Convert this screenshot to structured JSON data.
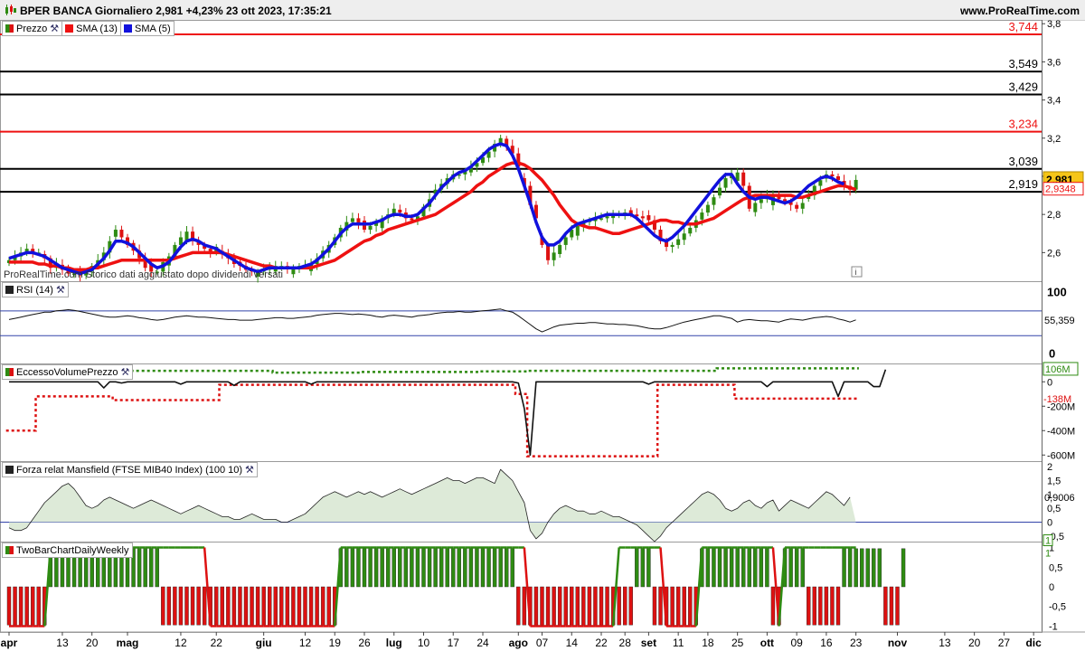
{
  "header": {
    "title": "BPER BANCA Giornaliero 2,981 +4,23% 23 ott 2023, 17:35:21",
    "site": "www.ProRealTime.com"
  },
  "watermark": "ProRealTime.com Storico dati aggiustato dopo dividendi versati",
  "colors": {
    "up": "#2e8b12",
    "down": "#dd1111",
    "sma13": "#ee1111",
    "sma5": "#1111dd",
    "hline_red": "#ee1111",
    "hline_black": "#000000",
    "rsi_band": "#3344aa",
    "area": "#d9e8d4",
    "mansfield_line": "#222222"
  },
  "x_axis": {
    "labels": [
      {
        "t": "apr",
        "d": 0,
        "m": true
      },
      {
        "t": "13",
        "d": 9
      },
      {
        "t": "20",
        "d": 14
      },
      {
        "t": "mag",
        "d": 20,
        "m": true
      },
      {
        "t": "12",
        "d": 29
      },
      {
        "t": "22",
        "d": 35
      },
      {
        "t": "giu",
        "d": 43,
        "m": true
      },
      {
        "t": "12",
        "d": 50
      },
      {
        "t": "19",
        "d": 55
      },
      {
        "t": "26",
        "d": 60
      },
      {
        "t": "lug",
        "d": 65,
        "m": true
      },
      {
        "t": "10",
        "d": 70
      },
      {
        "t": "17",
        "d": 75
      },
      {
        "t": "24",
        "d": 80
      },
      {
        "t": "ago",
        "d": 86,
        "m": true
      },
      {
        "t": "07",
        "d": 90
      },
      {
        "t": "14",
        "d": 95
      },
      {
        "t": "22",
        "d": 100
      },
      {
        "t": "28",
        "d": 104
      },
      {
        "t": "set",
        "d": 108,
        "m": true
      },
      {
        "t": "11",
        "d": 113
      },
      {
        "t": "18",
        "d": 118
      },
      {
        "t": "25",
        "d": 123
      },
      {
        "t": "ott",
        "d": 128,
        "m": true
      },
      {
        "t": "09",
        "d": 133
      },
      {
        "t": "16",
        "d": 138
      },
      {
        "t": "23",
        "d": 143
      },
      {
        "t": "nov",
        "d": 150,
        "m": true
      },
      {
        "t": "13",
        "d": 158
      },
      {
        "t": "20",
        "d": 163
      },
      {
        "t": "27",
        "d": 168
      },
      {
        "t": "dic",
        "d": 173,
        "m": true
      }
    ]
  },
  "panels": {
    "price": {
      "legend": [
        "Prezzo",
        "SMA (13)",
        "SMA (5)"
      ],
      "ticks": [
        "3,8",
        "3,6",
        "3,4",
        "3,2",
        "3",
        "2,8",
        "2,6"
      ],
      "hlines": [
        {
          "label": "3,744",
          "value": 3.744,
          "color": "red"
        },
        {
          "label": "3,549",
          "value": 3.549,
          "color": "black"
        },
        {
          "label": "3,429",
          "value": 3.429,
          "color": "black"
        },
        {
          "label": "3,234",
          "value": 3.234,
          "color": "red"
        },
        {
          "label": "3,039",
          "value": 3.039,
          "color": "black"
        },
        {
          "label": "2,919",
          "value": 2.919,
          "color": "black"
        }
      ],
      "last_price": "2,981",
      "sma13_last": "2,9348",
      "info_icon": "i"
    },
    "rsi": {
      "legend": "RSI (14)",
      "ticks": [
        "100",
        "0"
      ],
      "value": "55,359",
      "upper": 70,
      "lower": 30
    },
    "evp": {
      "legend": "EccessoVolumePrezzo",
      "ticks": [
        "0",
        "-200M",
        "-400M",
        "-600M"
      ],
      "upper_label": "106M",
      "lower_label": "-138M"
    },
    "mansfield": {
      "legend": "Forza relat Mansfield (FTSE MIB40 Index) (100 10)",
      "ticks": [
        "2",
        "1,5",
        "1",
        "0,5",
        "0",
        "-0,5"
      ],
      "value": "0,9006"
    },
    "twobar": {
      "legend": "TwoBarChartDailyWeekly",
      "ticks": [
        "1",
        "0,5",
        "0",
        "-0,5",
        "-1"
      ],
      "label_a": "1",
      "label_b": "1"
    }
  },
  "chart_data": [
    {
      "type": "candlestick",
      "title": "BPER BANCA Giornaliero",
      "ylim": [
        2.45,
        3.82
      ],
      "x_unit": "trading day index",
      "close": [
        2.56,
        2.58,
        2.6,
        2.62,
        2.6,
        2.6,
        2.57,
        2.52,
        2.54,
        2.51,
        2.49,
        2.49,
        2.48,
        2.5,
        2.53,
        2.56,
        2.6,
        2.66,
        2.72,
        2.68,
        2.64,
        2.61,
        2.57,
        2.52,
        2.5,
        2.5,
        2.55,
        2.58,
        2.64,
        2.68,
        2.71,
        2.66,
        2.64,
        2.62,
        2.6,
        2.63,
        2.59,
        2.57,
        2.54,
        2.53,
        2.51,
        2.5,
        2.5,
        2.51,
        2.52,
        2.53,
        2.53,
        2.52,
        2.52,
        2.53,
        2.53,
        2.54,
        2.57,
        2.61,
        2.64,
        2.68,
        2.73,
        2.76,
        2.78,
        2.75,
        2.72,
        2.74,
        2.76,
        2.78,
        2.8,
        2.83,
        2.81,
        2.78,
        2.77,
        2.79,
        2.84,
        2.88,
        2.93,
        2.96,
        2.99,
        3.01,
        3.01,
        3.03,
        3.05,
        3.07,
        3.1,
        3.13,
        3.17,
        3.2,
        3.16,
        3.12,
        3.05,
        2.95,
        2.85,
        2.78,
        2.64,
        2.56,
        2.6,
        2.64,
        2.68,
        2.72,
        2.74,
        2.76,
        2.77,
        2.78,
        2.78,
        2.79,
        2.8,
        2.8,
        2.81,
        2.8,
        2.79,
        2.78,
        2.77,
        2.72,
        2.66,
        2.63,
        2.64,
        2.67,
        2.7,
        2.73,
        2.77,
        2.81,
        2.85,
        2.89,
        2.94,
        2.99,
        3.01,
        3.02,
        2.95,
        2.83,
        2.86,
        2.88,
        2.9,
        2.9,
        2.88,
        2.87,
        2.85,
        2.83,
        2.86,
        2.9,
        2.95,
        2.98,
        3.01,
        3.0,
        2.98,
        2.95,
        2.93,
        2.981
      ],
      "sma13": [
        2.55,
        2.55,
        2.55,
        2.55,
        2.55,
        2.54,
        2.54,
        2.53,
        2.53,
        2.52,
        2.52,
        2.51,
        2.51,
        2.51,
        2.52,
        2.52,
        2.53,
        2.54,
        2.55,
        2.56,
        2.56,
        2.56,
        2.56,
        2.56,
        2.56,
        2.56,
        2.56,
        2.56,
        2.57,
        2.58,
        2.59,
        2.6,
        2.6,
        2.6,
        2.6,
        2.6,
        2.6,
        2.59,
        2.58,
        2.57,
        2.56,
        2.55,
        2.54,
        2.53,
        2.53,
        2.52,
        2.52,
        2.52,
        2.52,
        2.52,
        2.52,
        2.52,
        2.53,
        2.54,
        2.55,
        2.56,
        2.58,
        2.6,
        2.62,
        2.64,
        2.66,
        2.67,
        2.69,
        2.7,
        2.72,
        2.73,
        2.74,
        2.75,
        2.76,
        2.77,
        2.78,
        2.79,
        2.8,
        2.82,
        2.84,
        2.86,
        2.88,
        2.9,
        2.92,
        2.95,
        2.97,
        3.0,
        3.02,
        3.04,
        3.06,
        3.07,
        3.07,
        3.06,
        3.04,
        3.01,
        2.98,
        2.94,
        2.9,
        2.85,
        2.81,
        2.77,
        2.75,
        2.74,
        2.73,
        2.73,
        2.72,
        2.71,
        2.7,
        2.7,
        2.71,
        2.72,
        2.73,
        2.74,
        2.75,
        2.76,
        2.77,
        2.77,
        2.76,
        2.76,
        2.75,
        2.75,
        2.75,
        2.76,
        2.77,
        2.78,
        2.8,
        2.82,
        2.84,
        2.86,
        2.88,
        2.89,
        2.9,
        2.9,
        2.9,
        2.9,
        2.9,
        2.9,
        2.9,
        2.89,
        2.89,
        2.9,
        2.91,
        2.92,
        2.93,
        2.94,
        2.95,
        2.95,
        2.94,
        2.93
      ]
    },
    {
      "type": "line",
      "title": "SMA (5)",
      "values": [
        2.57,
        2.58,
        2.59,
        2.6,
        2.6,
        2.59,
        2.58,
        2.56,
        2.54,
        2.52,
        2.51,
        2.5,
        2.49,
        2.5,
        2.51,
        2.54,
        2.57,
        2.61,
        2.66,
        2.66,
        2.65,
        2.63,
        2.6,
        2.57,
        2.54,
        2.52,
        2.53,
        2.55,
        2.59,
        2.63,
        2.66,
        2.67,
        2.66,
        2.64,
        2.63,
        2.62,
        2.6,
        2.58,
        2.56,
        2.54,
        2.52,
        2.51,
        2.5,
        2.51,
        2.52,
        2.52,
        2.52,
        2.52,
        2.52,
        2.52,
        2.53,
        2.54,
        2.56,
        2.59,
        2.62,
        2.66,
        2.7,
        2.73,
        2.75,
        2.75,
        2.75,
        2.75,
        2.76,
        2.77,
        2.79,
        2.8,
        2.8,
        2.79,
        2.79,
        2.8,
        2.83,
        2.86,
        2.9,
        2.94,
        2.97,
        3.0,
        3.02,
        3.03,
        3.05,
        3.08,
        3.11,
        3.14,
        3.16,
        3.17,
        3.16,
        3.11,
        3.04,
        2.95,
        2.86,
        2.76,
        2.68,
        2.64,
        2.64,
        2.66,
        2.7,
        2.73,
        2.75,
        2.76,
        2.77,
        2.78,
        2.79,
        2.8,
        2.8,
        2.8,
        2.8,
        2.8,
        2.78,
        2.75,
        2.72,
        2.69,
        2.67,
        2.66,
        2.68,
        2.71,
        2.74,
        2.78,
        2.82,
        2.86,
        2.9,
        2.94,
        2.98,
        3.01,
        3.01,
        2.96,
        2.92,
        2.89,
        2.88,
        2.89,
        2.89,
        2.88,
        2.87,
        2.86,
        2.87,
        2.89,
        2.92,
        2.95,
        2.97,
        2.99,
        3.0,
        2.99,
        2.97,
        2.96
      ]
    },
    {
      "type": "line",
      "title": "RSI (14)",
      "ylim": [
        0,
        100
      ],
      "values": [
        56,
        58,
        60,
        62,
        64,
        66,
        68,
        68,
        70,
        71,
        72,
        71,
        69,
        67,
        65,
        63,
        61,
        60,
        60,
        61,
        62,
        61,
        59,
        58,
        56,
        55,
        56,
        58,
        60,
        61,
        62,
        61,
        60,
        60,
        59,
        58,
        57,
        56,
        56,
        55,
        55,
        55,
        56,
        57,
        58,
        59,
        59,
        58,
        58,
        59,
        60,
        61,
        63,
        64,
        65,
        66,
        66,
        65,
        64,
        65,
        64,
        63,
        61,
        60,
        62,
        63,
        62,
        61,
        60,
        62,
        63,
        64,
        66,
        67,
        68,
        68,
        69,
        68,
        68,
        69,
        70,
        71,
        72,
        73,
        70,
        68,
        62,
        55,
        48,
        41,
        36,
        40,
        44,
        47,
        48,
        49,
        50,
        50,
        51,
        51,
        50,
        49,
        49,
        48,
        48,
        47,
        46,
        44,
        42,
        41,
        41,
        43,
        46,
        49,
        52,
        54,
        56,
        58,
        60,
        62,
        62,
        60,
        58,
        52,
        55,
        56,
        55,
        54,
        54,
        53,
        52,
        55,
        57,
        56,
        55,
        57,
        59,
        60,
        61,
        60,
        57,
        55,
        52,
        55.4
      ]
    },
    {
      "type": "line",
      "title": "EccessoVolumePrezzo",
      "ylim": [
        -650,
        150
      ],
      "values": [
        0,
        0,
        0,
        0,
        0,
        0,
        0,
        0,
        0,
        0,
        0,
        0,
        0,
        0,
        0,
        0,
        -50,
        0,
        0,
        -10,
        0,
        0,
        0,
        0,
        0,
        0,
        0,
        0,
        0,
        -20,
        0,
        0,
        0,
        0,
        0,
        0,
        0,
        0,
        -30,
        0,
        0,
        0,
        0,
        0,
        0,
        0,
        0,
        0,
        0,
        0,
        0,
        -20,
        0,
        0,
        0,
        0,
        0,
        0,
        0,
        0,
        0,
        0,
        0,
        0,
        0,
        0,
        0,
        0,
        0,
        0,
        0,
        0,
        0,
        0,
        0,
        0,
        0,
        0,
        0,
        0,
        0,
        0,
        0,
        0,
        0,
        0,
        -10,
        -220,
        -600,
        0,
        0,
        0,
        0,
        0,
        0,
        0,
        0,
        0,
        0,
        0,
        0,
        0,
        0,
        0,
        0,
        0,
        0,
        0,
        -20,
        0,
        0,
        0,
        0,
        0,
        0,
        0,
        0,
        0,
        0,
        0,
        0,
        0,
        0,
        0,
        0,
        0,
        0,
        0,
        -40,
        0,
        0,
        0,
        0,
        0,
        0,
        0,
        0,
        0,
        0,
        0,
        -120,
        0,
        0,
        0,
        0,
        0,
        -40,
        -40,
        100
      ]
    },
    {
      "type": "area",
      "title": "Forza relat Mansfield (FTSE MIB40 Index) (100 10)",
      "ylim": [
        -0.7,
        2.2
      ],
      "values": [
        -0.2,
        -0.3,
        -0.3,
        -0.2,
        0.1,
        0.4,
        0.7,
        0.9,
        1.1,
        1.3,
        1.4,
        1.2,
        0.9,
        0.6,
        0.5,
        0.6,
        0.8,
        0.9,
        0.8,
        0.7,
        0.6,
        0.5,
        0.6,
        0.7,
        0.8,
        0.7,
        0.6,
        0.5,
        0.4,
        0.3,
        0.4,
        0.5,
        0.6,
        0.5,
        0.4,
        0.3,
        0.2,
        0.2,
        0.1,
        0.1,
        0.2,
        0.3,
        0.2,
        0.1,
        0.1,
        0.1,
        0.0,
        0.0,
        0.1,
        0.2,
        0.3,
        0.5,
        0.7,
        0.9,
        1.0,
        1.1,
        1.0,
        0.9,
        1.0,
        1.1,
        1.0,
        1.1,
        1.0,
        0.9,
        1.0,
        1.1,
        1.2,
        1.1,
        1.0,
        1.1,
        1.2,
        1.3,
        1.4,
        1.5,
        1.6,
        1.5,
        1.5,
        1.4,
        1.5,
        1.6,
        1.6,
        1.5,
        1.4,
        1.9,
        1.7,
        1.5,
        1.1,
        0.7,
        -0.3,
        -0.6,
        -0.4,
        0.0,
        0.3,
        0.5,
        0.6,
        0.5,
        0.4,
        0.4,
        0.3,
        0.3,
        0.4,
        0.3,
        0.2,
        0.2,
        0.1,
        0.0,
        -0.1,
        -0.3,
        -0.5,
        -0.7,
        -0.5,
        -0.2,
        0.0,
        0.2,
        0.4,
        0.6,
        0.8,
        1.0,
        1.1,
        1.0,
        0.8,
        0.5,
        0.4,
        0.5,
        0.7,
        0.8,
        0.6,
        0.5,
        0.7,
        0.8,
        0.4,
        0.6,
        0.8,
        0.7,
        0.6,
        0.5,
        0.7,
        0.9,
        1.1,
        1.0,
        0.8,
        0.6,
        0.9
      ]
    },
    {
      "type": "bar",
      "title": "TwoBarChartDailyWeekly",
      "ylim": [
        -1.15,
        1.15
      ],
      "daily": [
        -1,
        -1,
        -1,
        -1,
        -1,
        -1,
        -1,
        1,
        1,
        1,
        1,
        1,
        1,
        1,
        1,
        1,
        1,
        1,
        1,
        1,
        1,
        1,
        1,
        1,
        1,
        1,
        -1,
        -1,
        -1,
        -1,
        -1,
        -1,
        -1,
        -1,
        -1,
        -1,
        -1,
        -1,
        -1,
        -1,
        -1,
        -1,
        -1,
        -1,
        -1,
        -1,
        -1,
        -1,
        -1,
        -1,
        -1,
        -1,
        -1,
        -1,
        -1,
        -1,
        1,
        1,
        1,
        1,
        1,
        1,
        1,
        1,
        1,
        1,
        1,
        1,
        1,
        1,
        1,
        1,
        1,
        1,
        1,
        1,
        1,
        1,
        1,
        1,
        1,
        1,
        1,
        1,
        1,
        1,
        -1,
        -1,
        -1,
        -1,
        -1,
        -1,
        -1,
        -1,
        -1,
        -1,
        -1,
        -1,
        -1,
        -1,
        -1,
        -1,
        -1,
        -1,
        -1,
        -1,
        1,
        1,
        1,
        -1,
        -1,
        -1,
        -1,
        -1,
        -1,
        -1,
        -1,
        1,
        1,
        1,
        1,
        1,
        1,
        1,
        1,
        1,
        1,
        1,
        1,
        -1,
        -1,
        1,
        1,
        1,
        1,
        -1,
        -1,
        -1,
        -1,
        -1,
        -1,
        1,
        1,
        1,
        1,
        1,
        1,
        1,
        -1,
        -1,
        -1,
        1
      ],
      "weekly": [
        -1,
        -1,
        -1,
        -1,
        -1,
        -1,
        -1,
        1,
        1,
        1,
        1,
        1,
        1,
        1,
        1,
        1,
        1,
        1,
        1,
        1,
        1,
        1,
        1,
        1,
        1,
        1,
        1,
        1,
        1,
        1,
        1,
        1,
        1,
        1,
        -1,
        -1,
        -1,
        -1,
        -1,
        -1,
        -1,
        -1,
        -1,
        -1,
        -1,
        -1,
        -1,
        -1,
        -1,
        -1,
        -1,
        -1,
        -1,
        -1,
        -1,
        -1,
        1,
        1,
        1,
        1,
        1,
        1,
        1,
        1,
        1,
        1,
        1,
        1,
        1,
        1,
        1,
        1,
        1,
        1,
        1,
        1,
        1,
        1,
        1,
        1,
        1,
        1,
        1,
        1,
        1,
        1,
        1,
        1,
        -1,
        -1,
        -1,
        -1,
        -1,
        -1,
        -1,
        -1,
        -1,
        -1,
        -1,
        -1,
        -1,
        -1,
        -1,
        1,
        1,
        1,
        1,
        1,
        1,
        1,
        1,
        -1,
        -1,
        -1,
        -1,
        -1,
        -1,
        1,
        1,
        1,
        1,
        1,
        1,
        1,
        1,
        1,
        1,
        1,
        1,
        1,
        -1,
        1,
        1,
        1,
        1,
        1,
        1,
        1,
        1,
        1,
        1,
        1,
        1,
        1,
        1,
        1,
        1,
        1,
        1,
        1,
        1
      ]
    }
  ]
}
